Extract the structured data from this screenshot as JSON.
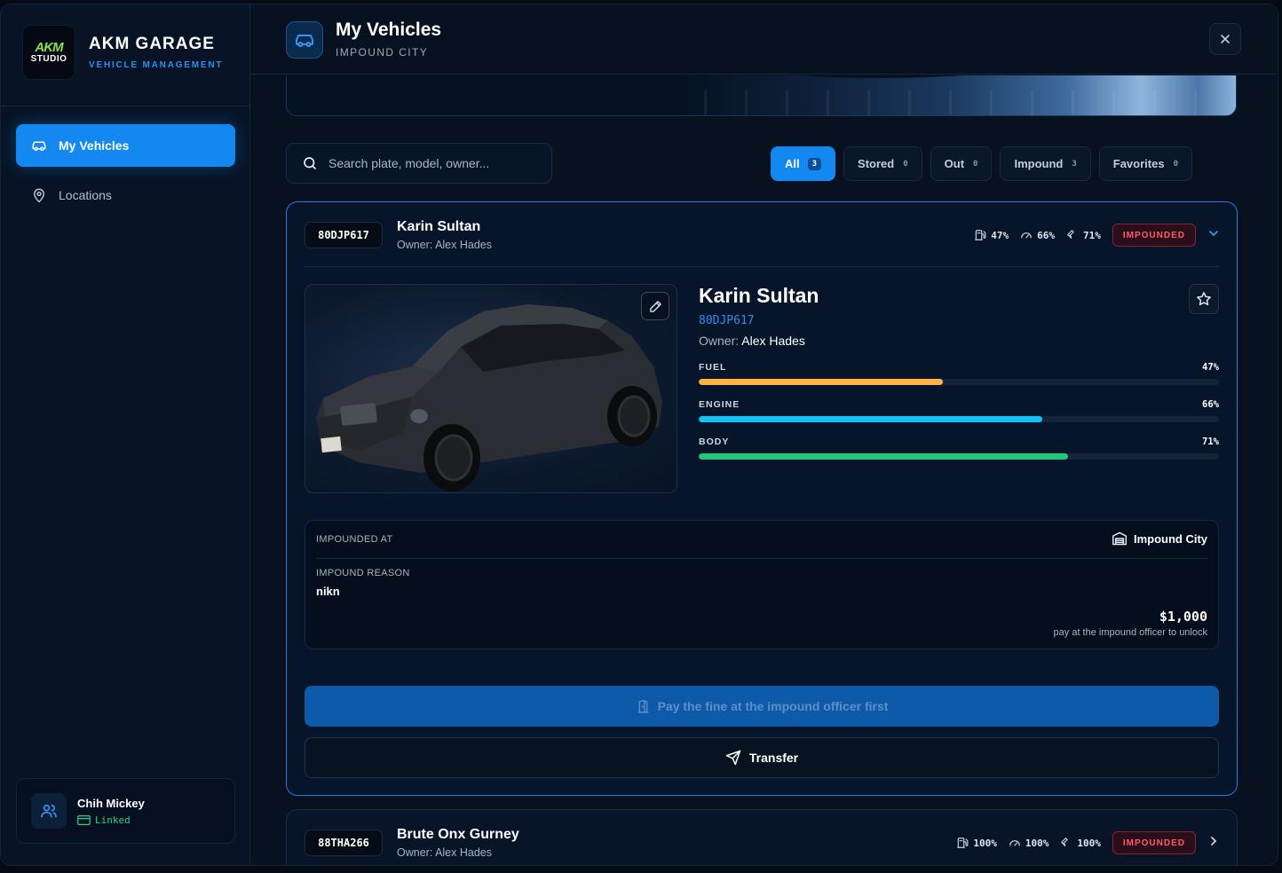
{
  "brand": {
    "logo_mark": "AKM",
    "logo_sub": "STUDIO",
    "title": "AKM GARAGE",
    "subtitle": "VEHICLE MANAGEMENT"
  },
  "sidebar": {
    "items": [
      {
        "label": "My Vehicles",
        "icon": "car-icon",
        "active": true
      },
      {
        "label": "Locations",
        "icon": "map-pin-icon",
        "active": false
      }
    ]
  },
  "user": {
    "name": "Chih Mickey",
    "status": "Linked",
    "status_color": "#2bd17e"
  },
  "header": {
    "title": "My Vehicles",
    "subtitle": "IMPOUND CITY",
    "close_icon": "close-icon"
  },
  "search": {
    "placeholder": "Search plate, model, owner..."
  },
  "filters": [
    {
      "label": "All",
      "count": "3",
      "active": true
    },
    {
      "label": "Stored",
      "count": "0"
    },
    {
      "label": "Out",
      "count": "0"
    },
    {
      "label": "Impound",
      "count": "3"
    },
    {
      "label": "Favorites",
      "count": "0"
    }
  ],
  "vehicles": [
    {
      "plate": "80DJP617",
      "name": "Karin Sultan",
      "owner_line": "Owner: Alex Hades",
      "owner_label": "Owner:",
      "owner_name": "Alex Hades",
      "fuel": "47%",
      "engine": "66%",
      "body": "71%",
      "status": "IMPOUNDED",
      "expanded": true,
      "bars": [
        {
          "label": "FUEL",
          "value": 47,
          "display": "47%",
          "color": "#ffb347"
        },
        {
          "label": "ENGINE",
          "value": 66,
          "display": "66%",
          "color": "#11c4f5"
        },
        {
          "label": "BODY",
          "value": 71,
          "display": "71%",
          "color": "#20c97a"
        }
      ],
      "impound": {
        "at_label": "IMPOUNDED AT",
        "location": "Impound City",
        "reason_label": "IMPOUND REASON",
        "reason": "nikn",
        "fine": "$1,000",
        "note": "pay at the impound officer to unlock"
      },
      "pay_label": "Pay the fine at the impound officer first",
      "transfer_label": "Transfer"
    },
    {
      "plate": "88THA266",
      "name": "Brute Onx Gurney",
      "owner_line": "Owner: Alex Hades",
      "fuel": "100%",
      "engine": "100%",
      "body": "100%",
      "status": "IMPOUNDED",
      "expanded": false
    }
  ],
  "colors": {
    "accent": "#1288f0",
    "danger": "#ff5a6b",
    "background": "#07111f"
  }
}
